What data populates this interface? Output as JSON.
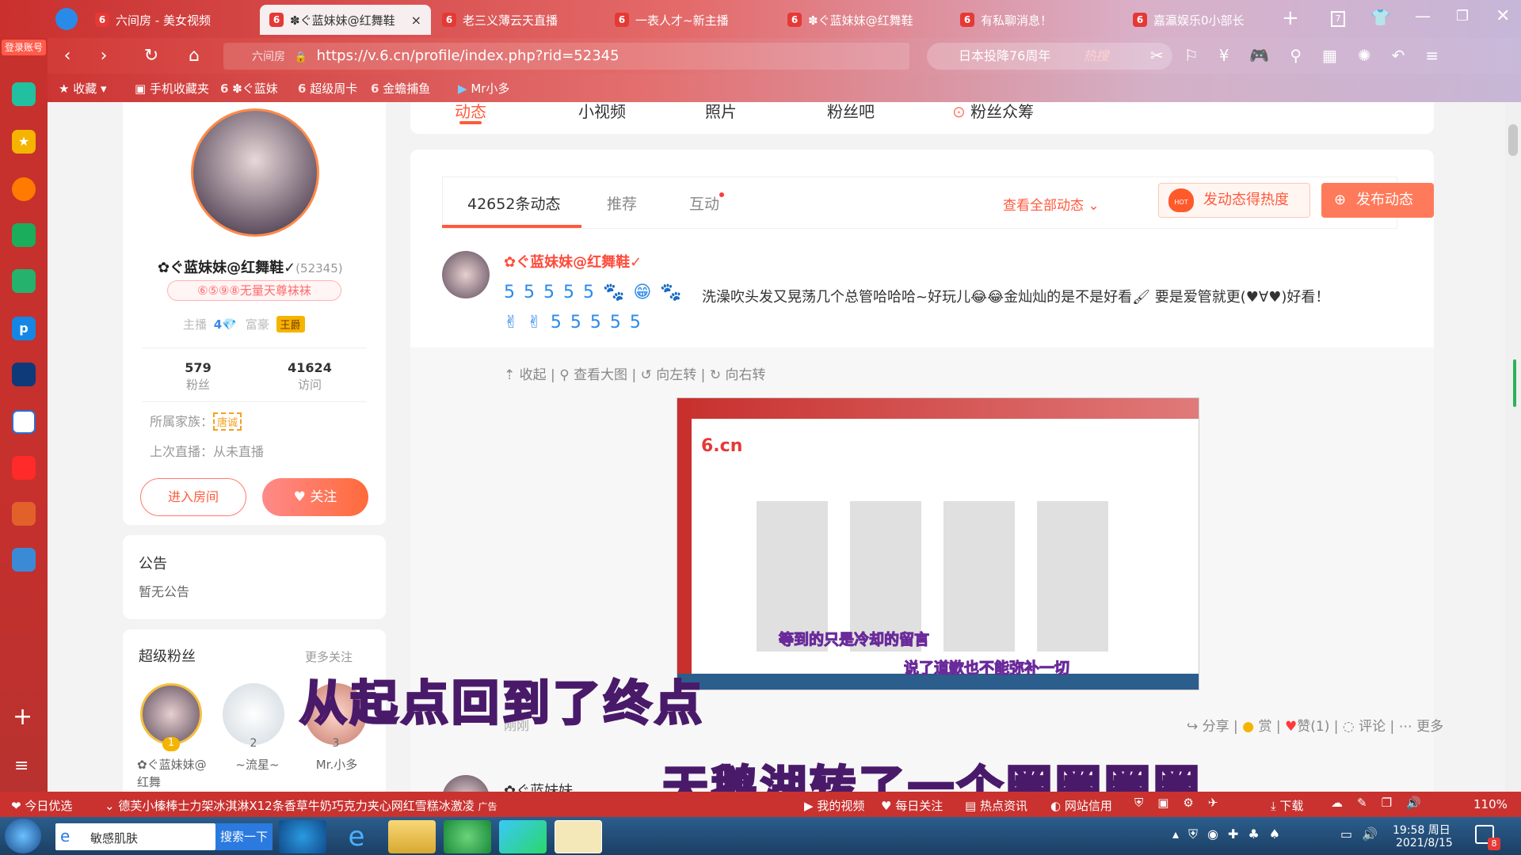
{
  "tabs": [
    {
      "label": "六间房 - 美女视频",
      "active": false
    },
    {
      "label": "✽ぐ蓝妹妹@红舞鞋",
      "active": true
    },
    {
      "label": "老三义薄云天直播",
      "active": false
    },
    {
      "label": "一表人才~新主播",
      "active": false
    },
    {
      "label": "✽ぐ蓝妹妹@红舞鞋",
      "active": false
    },
    {
      "label": "有私聊消息！",
      "active": false
    },
    {
      "label": "嘉瀛娱乐0小部长",
      "active": false
    }
  ],
  "tab_favicon": "6",
  "login_badge": "登录账号",
  "url": "https://v.6.cn/profile/index.php?rid=52345",
  "url_prefix": "六间房",
  "search_text": "日本投降76周年",
  "search_hot": "热搜",
  "bookmarks": [
    "收藏",
    "手机收藏夹",
    "✽ぐ蓝妹",
    "超级周卡",
    "金蟾捕鱼",
    "Mr小多"
  ],
  "profile": {
    "name": "✿ぐ蓝妹妹@红舞鞋✓",
    "rid": "(52345)",
    "badge": "⑥⑤⑨⑧无量天尊袜袜",
    "anchor_label": "主播",
    "anchor_level": "4",
    "rich_label": "富豪",
    "rich_badge": "王爵",
    "fans_count": "579",
    "fans_label": "粉丝",
    "visits_count": "41624",
    "visits_label": "访问",
    "family_label": "所属家族：",
    "family_name": "唐诚",
    "last_live": "上次直播：从未直播",
    "enter_room": "进入房间",
    "follow": "关注"
  },
  "notice": {
    "title": "公告",
    "content": "暂无公告"
  },
  "superfans": {
    "title": "超级粉丝",
    "more": "更多关注",
    "fans": [
      {
        "rank": "1",
        "name": "✿ぐ蓝妹妹@红舞"
      },
      {
        "rank": "2",
        "name": "~流星~"
      },
      {
        "rank": "3",
        "name": "Mr.小多"
      }
    ]
  },
  "profile_tabs": [
    "动态",
    "小视频",
    "照片",
    "粉丝吧",
    "粉丝众筹"
  ],
  "feed": {
    "tabs": [
      "42652条动态",
      "推荐",
      "互动"
    ],
    "view_all": "查看全部动态",
    "hot_button": "发动态得热度",
    "post_button": "发布动态",
    "hot_badge": "HOT",
    "post": {
      "author": "✿ぐ蓝妹妹@红舞鞋✓",
      "text": "洗澡吹头发又晃荡几个总管哈哈哈~好玩儿😂😂金灿灿的是不是好看🖌 要是爱管就更(♥∀♥)好看！",
      "time": "刚刚",
      "tools": [
        "收起",
        "查看大图",
        "向左转",
        "向右转"
      ],
      "actions": [
        "分享",
        "赏",
        "赞(1)",
        "评论",
        "更多"
      ],
      "second_author": "✿ぐ蓝妹妹"
    }
  },
  "captions": {
    "big": "从起点回到了终点",
    "bottom": "天鹅湖转了一个圈圈圈圈",
    "inner1": "等到的只是冷却的留言",
    "inner2": "说了道歉也不能弥补一切"
  },
  "statusbar": {
    "left": "今日优选",
    "news": "德芙小榛棒士力架冰淇淋X12条香草牛奶巧克力夹心网红雪糕冰激凌",
    "ad": "广告",
    "items": [
      "我的视频",
      "每日关注",
      "热点资讯",
      "网站信用"
    ],
    "download": "下载",
    "zoom": "110%"
  },
  "taskbar": {
    "search_app": "敏感肌肤",
    "search_btn": "搜索一下",
    "time": "19:58 周日",
    "date": "2021/8/15",
    "notify_count": "8"
  },
  "colors": {
    "accent": "#ff5a3c",
    "brand": "#e64a2e",
    "pink": "#ff6b8b"
  }
}
